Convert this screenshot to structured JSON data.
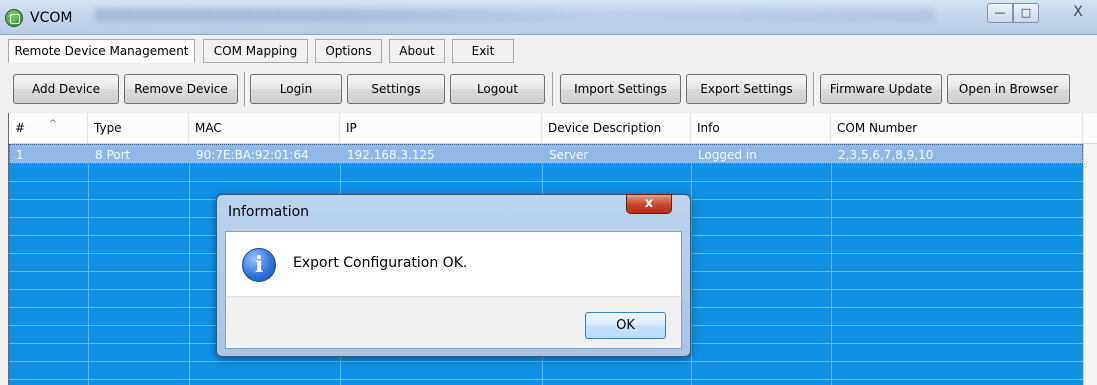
{
  "window": {
    "title": "VCOM",
    "icon": "vcom-app-icon",
    "controls": {
      "minimize": "—",
      "maximize": "□",
      "close": "X"
    }
  },
  "menu": {
    "tabs": [
      {
        "label": "Remote Device Management",
        "active": true
      },
      {
        "label": "COM Mapping"
      },
      {
        "label": "Options"
      },
      {
        "label": "About"
      },
      {
        "label": "Exit"
      }
    ]
  },
  "toolbar": {
    "buttons": [
      "Add Device",
      "Remove Device",
      "Login",
      "Settings",
      "Logout",
      "Import Settings",
      "Export Settings",
      "Firmware Update",
      "Open in Browser"
    ]
  },
  "table": {
    "columns": [
      "#",
      "Type",
      "MAC",
      "IP",
      "Device Description",
      "Info",
      "COM Number"
    ],
    "rows": [
      {
        "num": "1",
        "type": "8 Port",
        "mac": "90:7E:BA:92:01:64",
        "ip": "192.168.3.125",
        "desc": "Server",
        "info": "Logged in",
        "com": "2,3,5,6,7,8,9,10"
      }
    ],
    "colors": {
      "background": "#1191e6",
      "selected_row": "#8fb8e6"
    }
  },
  "dialog": {
    "title": "Information",
    "close_label": "x",
    "icon": "info-icon",
    "message": "Export Configuration OK.",
    "ok_label": "OK"
  }
}
